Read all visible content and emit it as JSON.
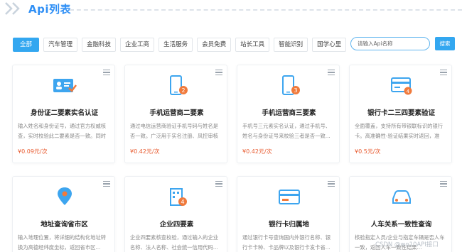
{
  "page": {
    "title": "Api列表"
  },
  "tabs": [
    "全部",
    "汽车管理",
    "金融科技",
    "企业工商",
    "生活服务",
    "会员免费",
    "站长工具",
    "智能识别",
    "国学心里"
  ],
  "search": {
    "placeholder": "请输入Api名称",
    "button_label": "搜索"
  },
  "cards": [
    {
      "name": "身份证二要素实名认证",
      "desc": "输入姓名和身份证号，通过官方权威核查，实时校验此二要素是否一致。同时返回...",
      "price": "¥0.09元/次",
      "icon": "id-card-icon"
    },
    {
      "name": "手机运营商二要素",
      "desc": "通过电信运营商验证手机号码与姓名是否一致。广泛用于实名注册、风控审核等场景...",
      "price": "¥0.42元/次",
      "icon": "phone-2-icon"
    },
    {
      "name": "手机运营商三要素",
      "desc": "手机号三元素实名认证，通过手机号、姓名与身份证号来校验三者是否一致...",
      "price": "¥0.42元/次",
      "icon": "phone-3-icon"
    },
    {
      "name": "银行卡二三四要素验证",
      "desc": "全面覆盖，支持所有带银联标识的银行卡。高准确性-验证结果实时返回，准确...",
      "price": "¥0.5元/次",
      "icon": "bank-card-icon"
    },
    {
      "name": "地址查询省市区",
      "desc": "输入地理位置，将详细的结构化地址转换为高德经纬度坐标，返回省市区...",
      "price": "",
      "icon": "map-pin-icon"
    },
    {
      "name": "企业四要素",
      "desc": "企业四要素核查校验，通过输入的企业名称、法人名称、社会统一信用代码...",
      "price": "",
      "icon": "building-4-icon"
    },
    {
      "name": "银行卡归属地",
      "desc": "通过银行卡号查询国内外银行名称、银行卡卡种、卡品牌以及银行卡发卡省...",
      "price": "",
      "icon": "card-icon"
    },
    {
      "name": "人车关系一致性查询",
      "desc": "核验指定人员/企业与指定车辆是否人车一致，返回人车一致性结果...",
      "price": "",
      "icon": "car-icon"
    }
  ],
  "watermark": "CSDN @wo10API接口",
  "colors": {
    "accent": "#33a7f0",
    "title": "#2f8ff5",
    "price": "#e85a2f",
    "badge": "#f07a3c"
  }
}
